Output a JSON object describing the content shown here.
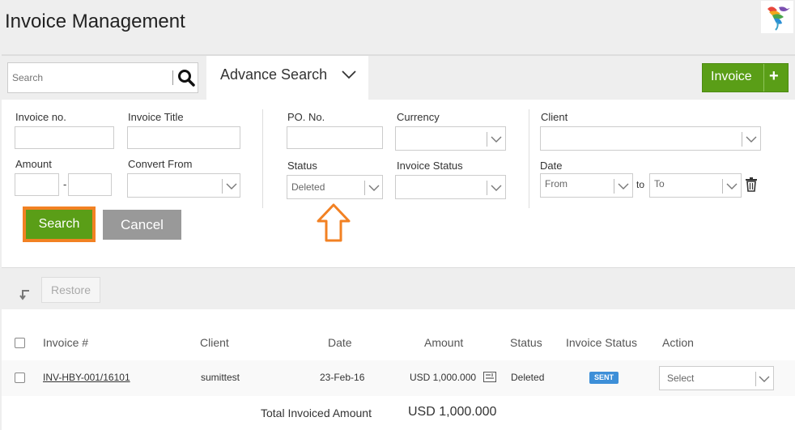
{
  "header": {
    "title": "Invoice Management"
  },
  "toolbar": {
    "search_placeholder": "Search",
    "advance_search_label": "Advance Search",
    "invoice_button_label": "Invoice",
    "invoice_button_plus": "+"
  },
  "filters": {
    "invoice_no_label": "Invoice no.",
    "invoice_title_label": "Invoice Title",
    "amount_label": "Amount",
    "amount_dash": "-",
    "convert_from_label": "Convert From",
    "po_no_label": "PO. No.",
    "currency_label": "Currency",
    "status_label": "Status",
    "status_value": "Deleted",
    "invoice_status_label": "Invoice Status",
    "client_label": "Client",
    "date_label": "Date",
    "date_from_placeholder": "From",
    "date_to_text": "to",
    "date_to_placeholder": "To",
    "search_button": "Search",
    "cancel_button": "Cancel"
  },
  "bulk": {
    "restore_button": "Restore"
  },
  "table": {
    "headers": [
      "Invoice #",
      "Client",
      "Date",
      "Amount",
      "Status",
      "Invoice Status",
      "Action"
    ],
    "rows": [
      {
        "invoice_no": "INV-HBY-001/16101",
        "client": "sumittest",
        "date": "23-Feb-16",
        "amount": "USD 1,000.000",
        "status": "Deleted",
        "invoice_status": "SENT",
        "action_placeholder": "Select"
      }
    ],
    "total_label": "Total Invoiced Amount",
    "total_value": "USD 1,000.000"
  },
  "colors": {
    "accent_green": "#5a9e17",
    "highlight_orange": "#f28123",
    "badge_blue": "#3d8fd8",
    "cancel_gray": "#999999"
  }
}
